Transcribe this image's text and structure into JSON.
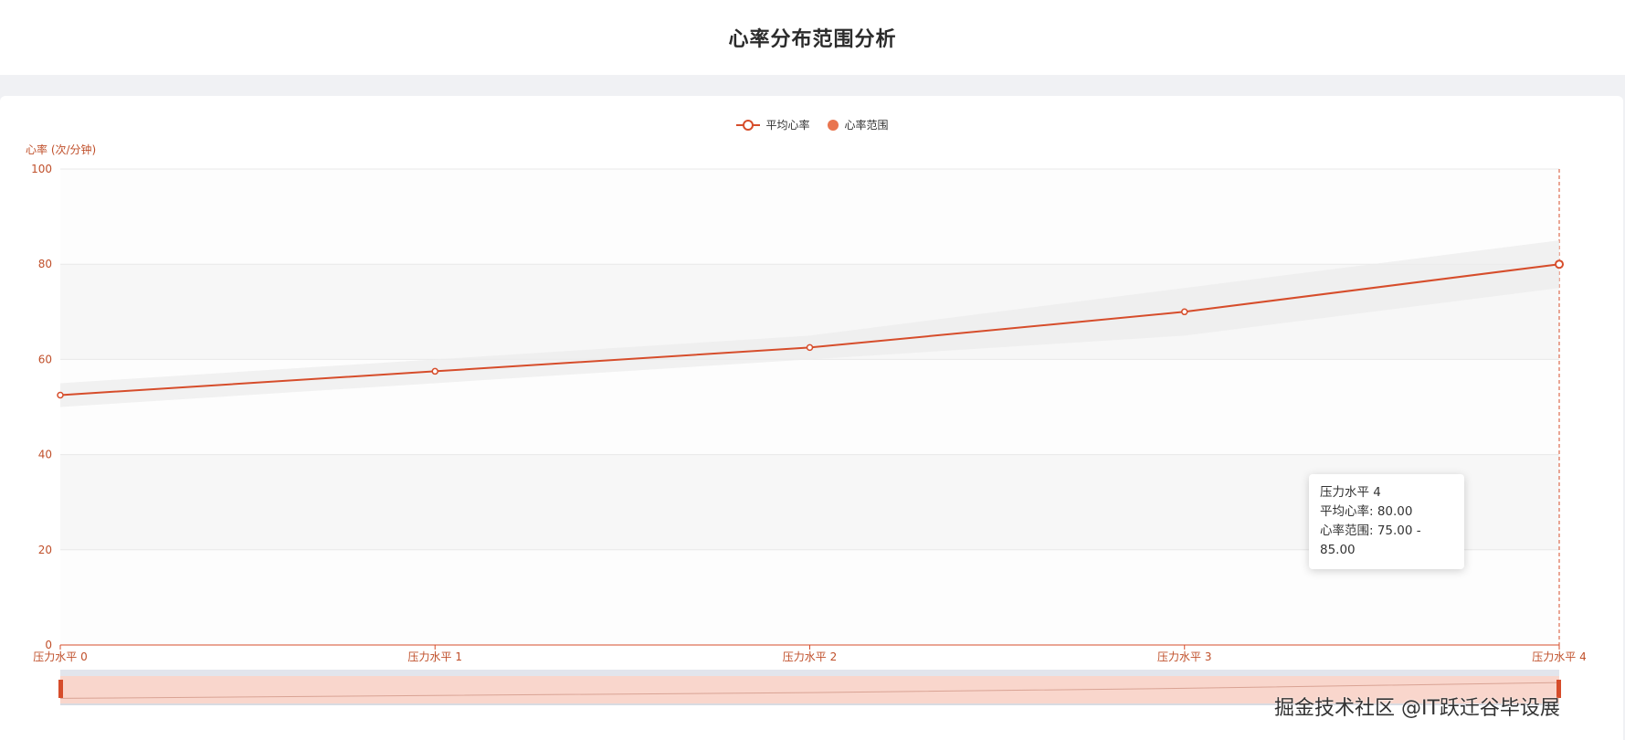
{
  "page": {
    "title": "心率分布范围分析"
  },
  "legend": {
    "avg_label": "平均心率",
    "range_label": "心率范围"
  },
  "tooltip": {
    "title": "压力水平 4",
    "avg_line": "平均心率: 80.00",
    "range_line": "心率范围: 75.00 - 85.00"
  },
  "watermark": "掘金技术社区 @IT跃迁谷毕设展",
  "colors": {
    "accent": "#d64d2b",
    "range_fill": "#ececec",
    "slider_fill": "#f9d6cc",
    "grid": "#e8e8e8"
  },
  "chart_data": {
    "type": "line",
    "title": "",
    "ylabel": "心率 (次/分钟)",
    "xlabel": "",
    "ylim": [
      0,
      100
    ],
    "yticks": [
      0,
      20,
      40,
      60,
      80,
      100
    ],
    "categories": [
      "压力水平 0",
      "压力水平 1",
      "压力水平 2",
      "压力水平 3",
      "压力水平 4"
    ],
    "series": [
      {
        "name": "平均心率",
        "values": [
          52.5,
          57.5,
          62.5,
          70,
          80
        ]
      },
      {
        "name": "心率范围",
        "lower": [
          50,
          55,
          60,
          65,
          75
        ],
        "upper": [
          55,
          60,
          65,
          75,
          85
        ]
      }
    ],
    "grid": true,
    "legend_position": "top-center",
    "highlighted_category": "压力水平 4"
  }
}
